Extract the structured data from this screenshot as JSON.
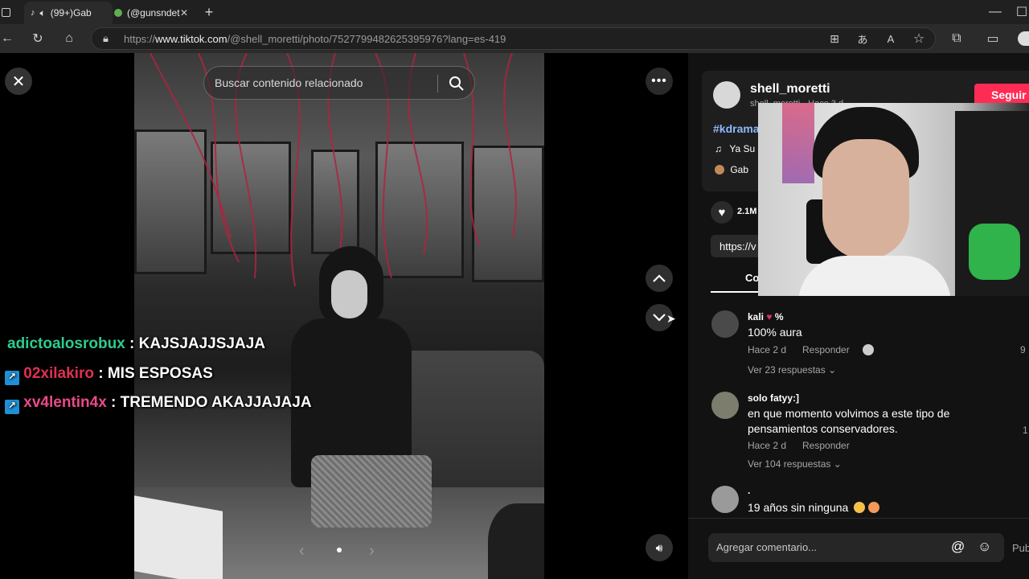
{
  "browser": {
    "tabs": [
      {
        "label": "(99+)Gab"
      },
      {
        "label": "(@gunsndet"
      }
    ],
    "url_prefix": "https://",
    "url_host": "www.tiktok.com",
    "url_path": "/@shell_moretti/photo/7527799482625395976?lang=es-419"
  },
  "viewer": {
    "search_placeholder": "Buscar contenido relacionado"
  },
  "chat": [
    {
      "user": "adictoalosrobux",
      "sep": " : ",
      "message": "KAJSJAJJSJAJA",
      "color": "#2ecc8f",
      "badge": false
    },
    {
      "user": "02xilakiro",
      "sep": " : ",
      "message": "MIS ESPOSAS",
      "color": "#e0304f",
      "badge": true
    },
    {
      "user": "xv4lentin4x",
      "sep": " : ",
      "message": "TREMENDO AKAJJAJAJA",
      "color": "#e94a8a",
      "badge": true
    }
  ],
  "panel": {
    "username": "shell_moretti",
    "subline": "shell_moretti · Hace 3 d",
    "follow_label": "Seguir",
    "hashtag": "#kdrama",
    "music": "Ya Su",
    "gab_label": "Gab",
    "likes": "2.1M",
    "link_preview": "https://v",
    "tab_comments": "Co",
    "comments": [
      {
        "user": "kali",
        "user_suffix": "%",
        "text": "100% aura",
        "time": "Hace 2 d",
        "reply": "Responder",
        "replies": "Ver 23 respuestas",
        "count": "9"
      },
      {
        "user": "solo fatyy:]",
        "user_suffix": "",
        "text": "en que momento volvimos a este tipo de pensamientos conservadores.",
        "time": "Hace 2 d",
        "reply": "Responder",
        "replies": "Ver 104 respuestas",
        "count": "1"
      },
      {
        "user": ".",
        "user_suffix": "",
        "text": "19 años sin ninguna",
        "time": "",
        "reply": "",
        "replies": "",
        "count": ""
      }
    ],
    "comment_placeholder": "Agregar comentario...",
    "post_label": "Pub"
  },
  "colors": {
    "accent": "#fe2c55",
    "hashtag": "#8fb8ff",
    "panel_bg": "#121212"
  }
}
